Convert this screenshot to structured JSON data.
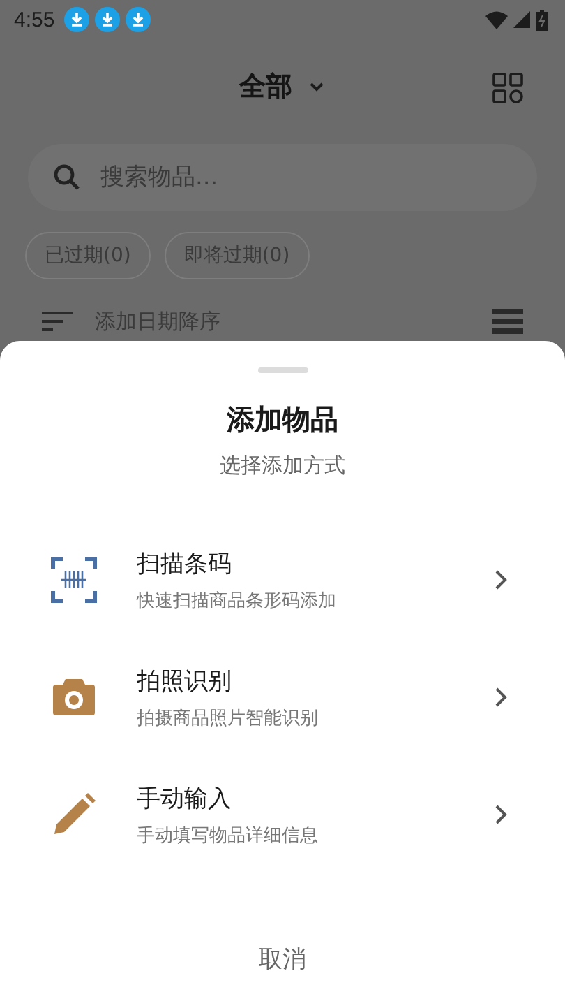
{
  "status_bar": {
    "time": "4:55",
    "notifications": [
      {
        "kind": "download"
      },
      {
        "kind": "download"
      },
      {
        "kind": "download"
      }
    ]
  },
  "header": {
    "title": "全部"
  },
  "search": {
    "placeholder": "搜索物品..."
  },
  "filters": [
    {
      "label": "已过期(0)"
    },
    {
      "label": "即将过期(0)"
    }
  ],
  "sort": {
    "label": "添加日期降序"
  },
  "sheet": {
    "title": "添加物品",
    "subtitle": "选择添加方式",
    "options": [
      {
        "kind": "scan",
        "title": "扫描条码",
        "description": "快速扫描商品条形码添加"
      },
      {
        "kind": "camera",
        "title": "拍照识别",
        "description": "拍摄商品照片智能识别"
      },
      {
        "kind": "pencil",
        "title": "手动输入",
        "description": "手动填写物品详细信息"
      }
    ],
    "cancel": "取消"
  }
}
